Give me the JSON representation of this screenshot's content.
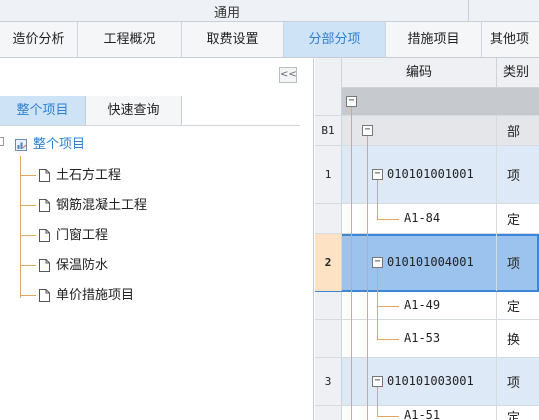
{
  "top": {
    "title": "通用"
  },
  "tabs": [
    {
      "label": "造价分析",
      "active": false
    },
    {
      "label": "工程概况",
      "active": false
    },
    {
      "label": "取费设置",
      "active": false
    },
    {
      "label": "分部分项",
      "active": true
    },
    {
      "label": "措施项目",
      "active": false
    },
    {
      "label": "其他项",
      "active": false
    }
  ],
  "left": {
    "collapse_label": "<<",
    "subtabs": {
      "whole": "整个项目",
      "quick": "快速查询"
    },
    "tree_root": "整个项目",
    "tree_items": [
      "土石方工程",
      "钢筋混凝土工程",
      "门窗工程",
      "保温防水",
      "单价措施项目"
    ]
  },
  "grid": {
    "headers": {
      "code": "编码",
      "type": "类别"
    },
    "rows": [
      {
        "idx": "",
        "code": "",
        "type": ""
      },
      {
        "idx": "B1",
        "code": "",
        "type": "部"
      },
      {
        "idx": "1",
        "code": "010101001001",
        "type": "项"
      },
      {
        "idx": "",
        "code": "A1-84",
        "type": "定"
      },
      {
        "idx": "2",
        "code": "010101004001",
        "type": "项"
      },
      {
        "idx": "",
        "code": "A1-49",
        "type": "定"
      },
      {
        "idx": "",
        "code": "A1-53",
        "type": "换"
      },
      {
        "idx": "3",
        "code": "010101003001",
        "type": "项"
      },
      {
        "idx": "",
        "code": "A1-51",
        "type": "定"
      }
    ],
    "expander_minus": "−"
  },
  "colors": {
    "accent": "#2f7fd0",
    "tab_active_bg": "#cfe3f7",
    "tree_line": "#e3a860",
    "selected_row": "#9cc3ee"
  }
}
